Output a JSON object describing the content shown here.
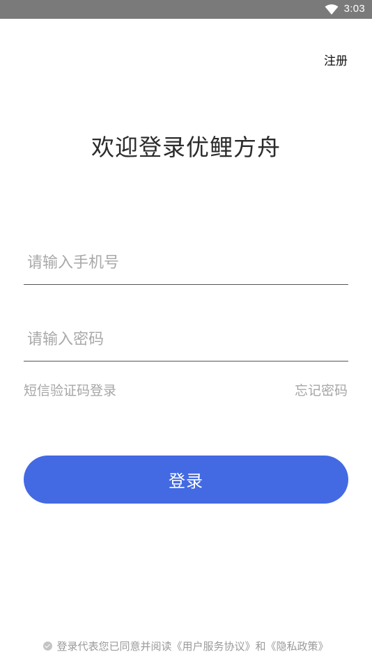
{
  "status_bar": {
    "time": "3:03",
    "wifi_icon": "wifi-icon"
  },
  "header": {
    "register_label": "注册"
  },
  "title": "欢迎登录优鲤方舟",
  "form": {
    "phone_placeholder": "请输入手机号",
    "password_placeholder": "请输入密码",
    "sms_login_label": "短信验证码登录",
    "forgot_password_label": "忘记密码",
    "login_button_label": "登录"
  },
  "agreement": {
    "check_icon": "checkmark-circle-icon",
    "prefix": "登录代表您已同意并阅读",
    "user_agreement": "《用户服务协议》",
    "conjunction": "和",
    "privacy_policy": "《隐私政策》"
  },
  "colors": {
    "status_bar_bg": "#7a7a7a",
    "primary_button": "#436ae3",
    "placeholder_text": "#a9a9a9",
    "secondary_text": "#a6a6a6"
  }
}
